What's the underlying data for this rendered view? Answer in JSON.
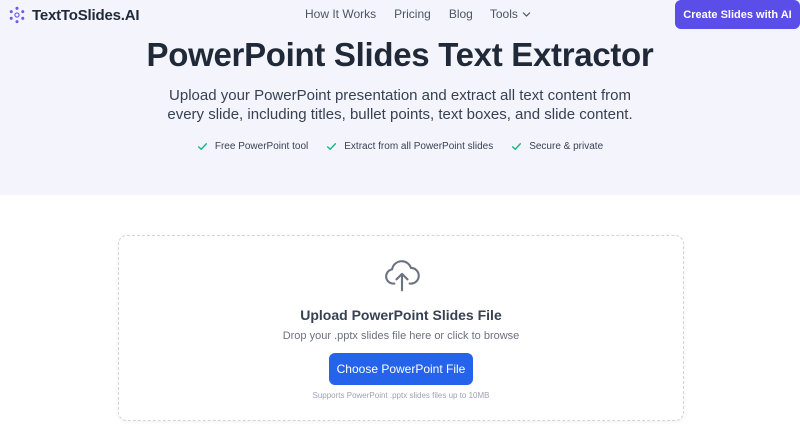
{
  "nav": {
    "brand": "TextToSlides.AI",
    "links": [
      "How It Works",
      "Pricing",
      "Blog"
    ],
    "tools_label": "Tools",
    "cta_label": "Create Slides with AI"
  },
  "hero": {
    "title": "PowerPoint Slides Text Extractor",
    "subtitle": "Upload your PowerPoint presentation and extract all text content from every slide, including titles, bullet points, text boxes, and slide content.",
    "features": [
      "Free PowerPoint tool",
      "Extract from all PowerPoint slides",
      "Secure & private"
    ]
  },
  "upload": {
    "title": "Upload PowerPoint Slides File",
    "subtitle": "Drop your .pptx slides file here or click to browse",
    "button_label": "Choose PowerPoint File",
    "note": "Supports PowerPoint .pptx slides files up to 10MB"
  },
  "colors": {
    "accent_purple": "#5b4de8",
    "button_blue": "#2563eb",
    "check_green": "#10b981",
    "hero_bg": "#f4f5fc"
  },
  "icons": {
    "logo": "hexagon-dots-logo",
    "tools_chevron": "chevron-down-icon",
    "feature_check": "check-icon",
    "upload": "cloud-upload-icon"
  }
}
